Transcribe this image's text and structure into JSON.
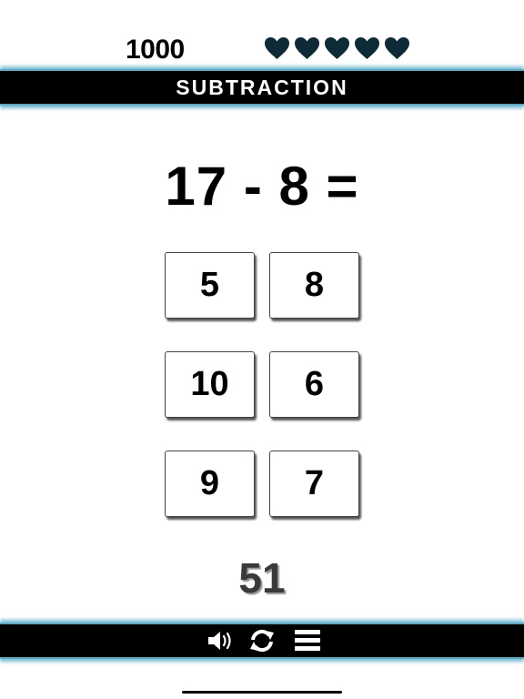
{
  "hud": {
    "score": "1000",
    "lives": 5,
    "heart_color": "#0e2a36"
  },
  "banner": {
    "title": "SUBTRACTION"
  },
  "question": {
    "equation": "17 - 8 ="
  },
  "answers": [
    "5",
    "8",
    "10",
    "6",
    "9",
    "7"
  ],
  "timer": {
    "value": "51"
  },
  "toolbar": {
    "icons": [
      "speaker-icon",
      "refresh-icon",
      "menu-icon"
    ]
  },
  "colors": {
    "bar_background": "#000000",
    "bar_glow": "#7bbcd2",
    "timer_text": "#3a3a3a"
  }
}
